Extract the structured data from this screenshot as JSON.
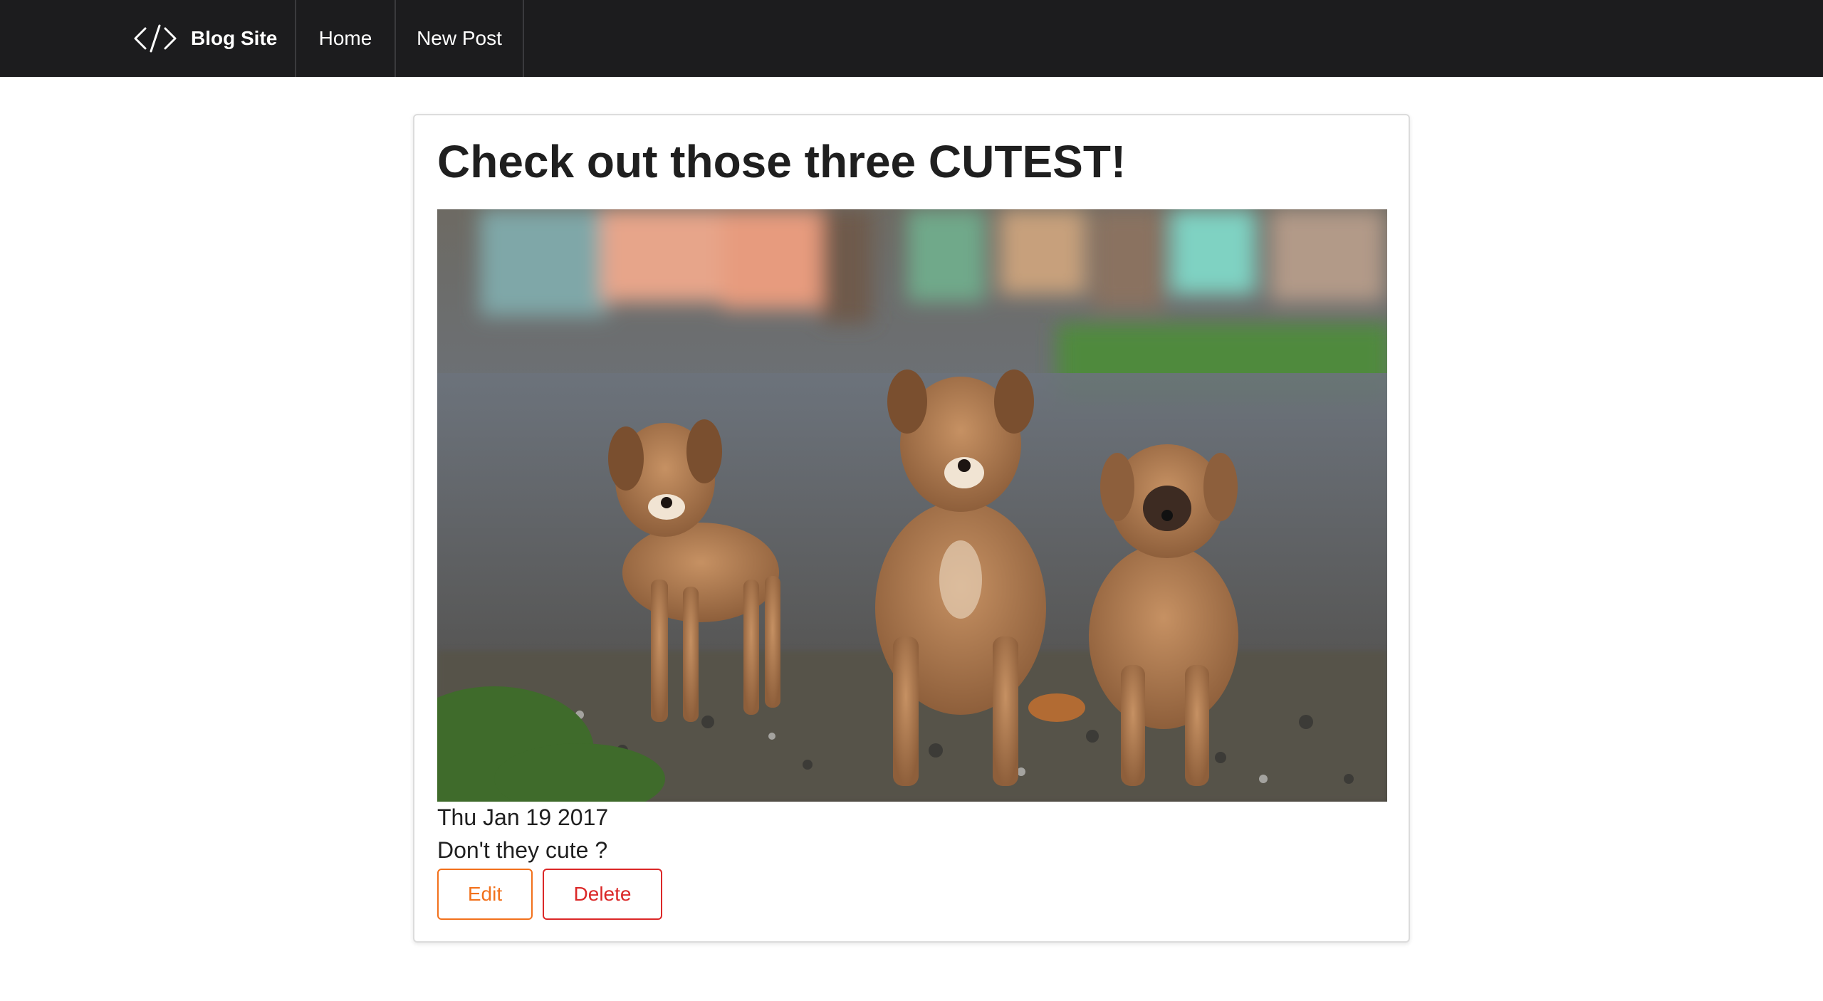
{
  "navbar": {
    "brand_label": "Blog Site",
    "brand_icon": "code-icon",
    "home_label": "Home",
    "new_post_label": "New Post"
  },
  "post": {
    "title": "Check out those three CUTEST!",
    "image_description_icon": "photo-three-puppies",
    "date": "Thu Jan 19 2017",
    "body": "Don't they cute ?",
    "edit_label": "Edit",
    "delete_label": "Delete"
  },
  "colors": {
    "navbar_bg": "#1c1c1e",
    "edit_accent": "#f2711c",
    "delete_accent": "#db2828",
    "text": "#1f1f1f"
  }
}
